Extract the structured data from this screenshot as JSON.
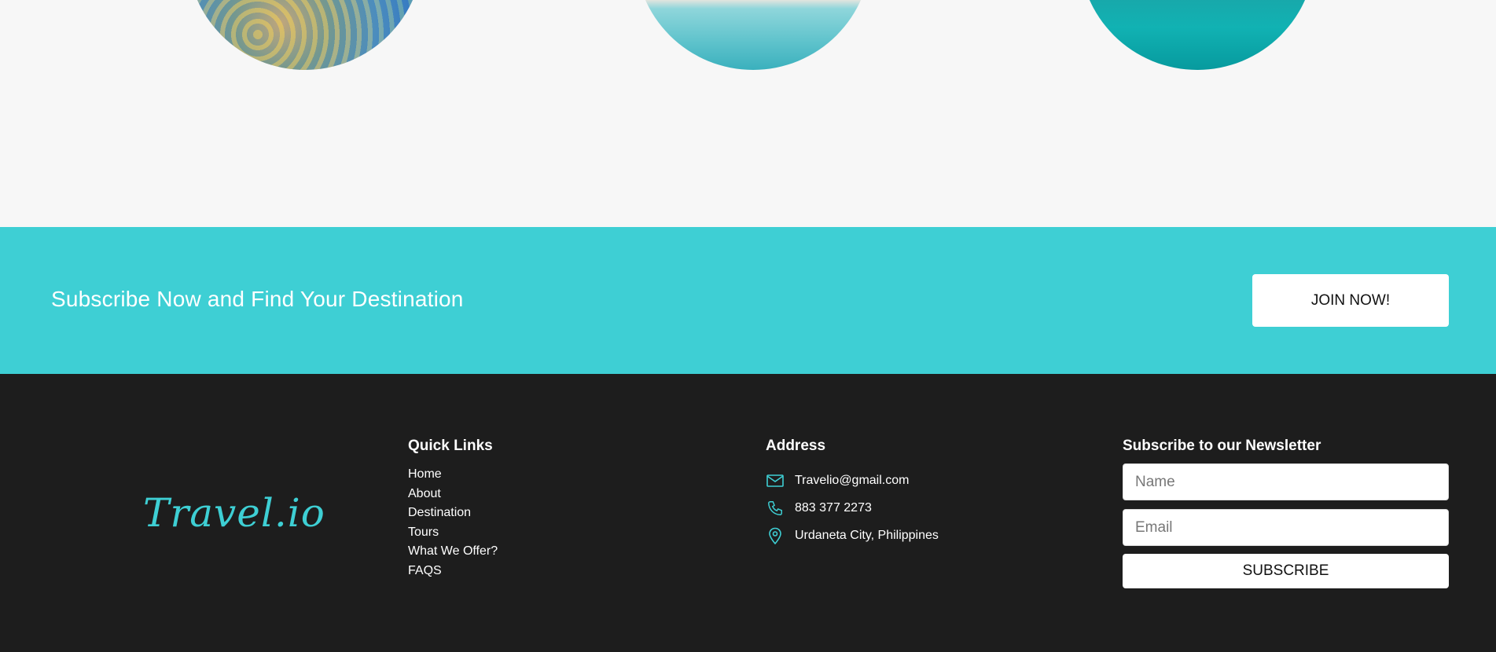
{
  "banner": {
    "title": "Subscribe Now and Find Your Destination",
    "join_label": "JOIN NOW!"
  },
  "footer": {
    "logo": "Travel.io",
    "quick_links": {
      "title": "Quick Links",
      "items": [
        "Home",
        "About",
        "Destination",
        "Tours",
        "What We Offer?",
        "FAQS"
      ]
    },
    "address": {
      "title": "Address",
      "email": {
        "icon": "mail-icon",
        "text": "Travelio@gmail.com"
      },
      "phone": {
        "icon": "phone-icon",
        "text": "883 377 2273"
      },
      "location": {
        "icon": "location-pin-icon",
        "text": "Urdaneta City, Philippines"
      }
    },
    "newsletter": {
      "title": "Subscribe to our Newsletter",
      "name_placeholder": "Name",
      "email_placeholder": "Email",
      "subscribe_label": "SUBSCRIBE"
    }
  },
  "colors": {
    "accent": "#3ecfd4",
    "footer_bg": "#1d1d1d",
    "page_bg": "#f7f7f7"
  }
}
